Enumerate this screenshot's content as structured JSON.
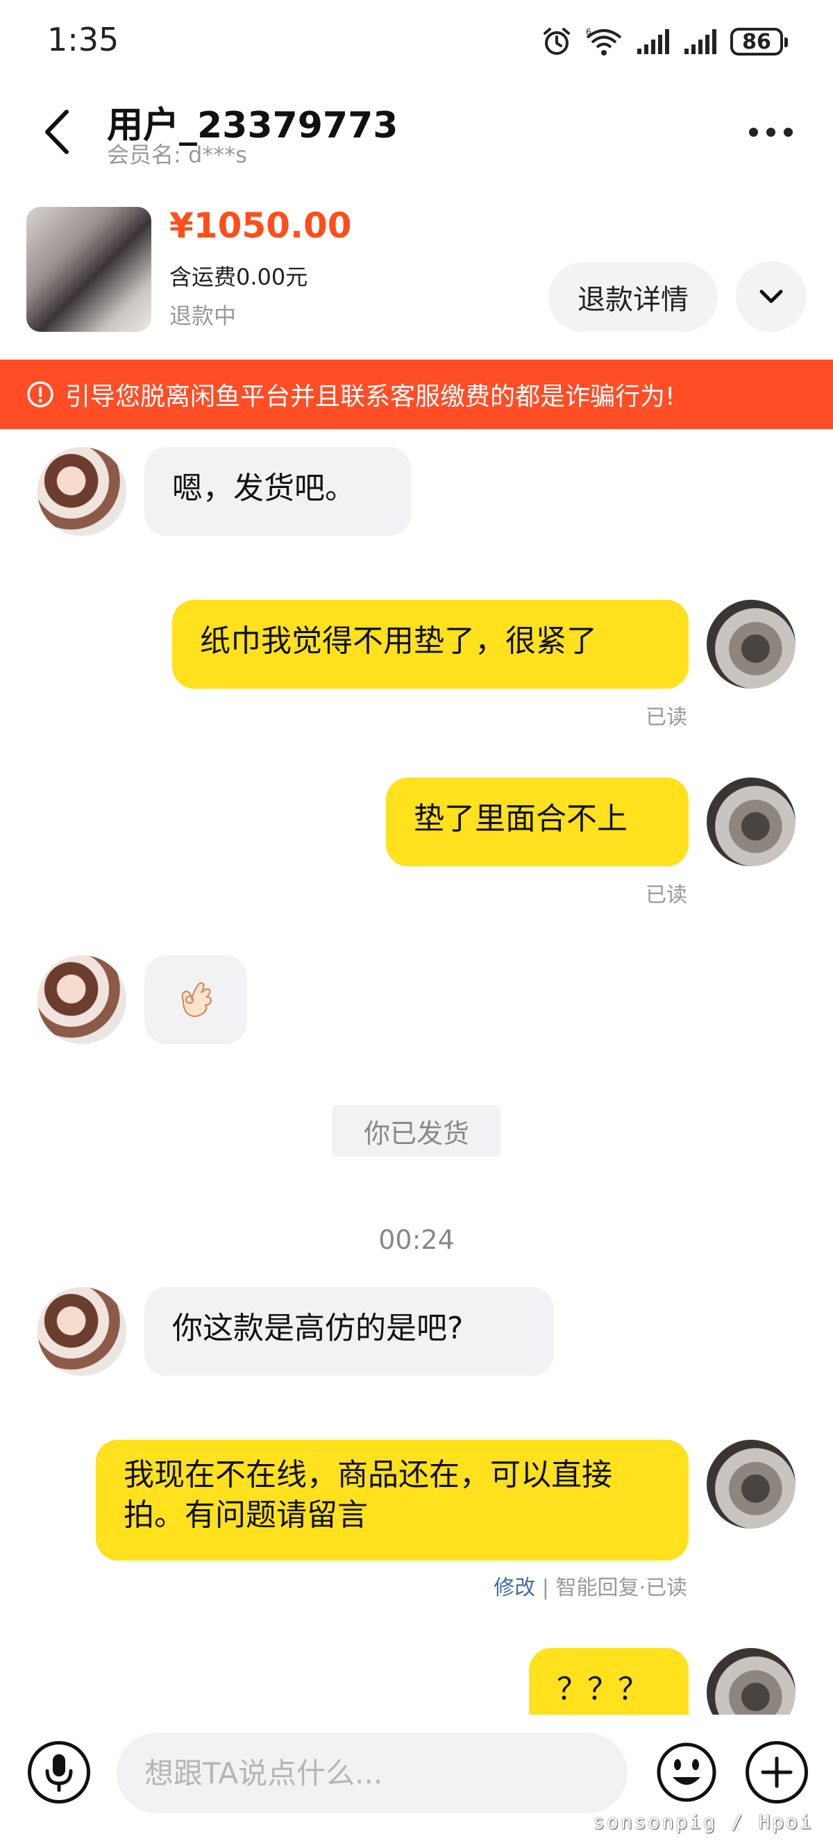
{
  "status_bar": {
    "time": "1:35",
    "battery": "86",
    "icons": [
      "alarm-icon",
      "wifi-6-icon",
      "signal-icon",
      "signal-icon",
      "battery-icon"
    ]
  },
  "header": {
    "user_name": "用户_23379773",
    "member_label": "会员名:",
    "member_name": "d***s",
    "more_icon": "more-icon",
    "back_icon": "back-arrow-icon"
  },
  "product": {
    "price": "¥1050.00",
    "shipping": "含运费0.00元",
    "status": "退款中",
    "refund_button": "退款详情",
    "expand_icon": "chevron-down-icon"
  },
  "warning": {
    "text": "引导您脱离闲鱼平台并且联系客服缴费的都是诈骗行为!",
    "icon": "exclamation-circle-icon",
    "color": "#ff4d26"
  },
  "messages": [
    {
      "from": "other",
      "text": "嗯，发货吧。"
    },
    {
      "from": "me",
      "text": "纸巾我觉得不用垫了，很紧了",
      "status": "已读"
    },
    {
      "from": "me",
      "text": "垫了里面合不上",
      "status": "已读"
    },
    {
      "from": "other",
      "type": "emoji",
      "icon": "ok-hand-emoji"
    },
    {
      "from": "system",
      "text": "你已发货"
    },
    {
      "from": "time",
      "text": "00:24"
    },
    {
      "from": "other",
      "text": "你这款是高仿的是吧?"
    },
    {
      "from": "me",
      "text": "我现在不在线，商品还在，可以直接拍。有问题请留言",
      "edit": "修改",
      "separator": "|",
      "meta": "智能回复·已读"
    },
    {
      "from": "me",
      "text": "？？？"
    }
  ],
  "input": {
    "placeholder": "想跟TA说点什么...",
    "voice_icon": "microphone-icon",
    "emoji_icon": "smiley-icon",
    "add_icon": "plus-circle-icon"
  },
  "watermark": "sonsonpig / Hpoi",
  "colors": {
    "accent_yellow": "#ffe11d",
    "price_orange": "#ff4e19",
    "bubble_gray": "#f2f2f4",
    "link_blue": "#3d6ea5"
  }
}
